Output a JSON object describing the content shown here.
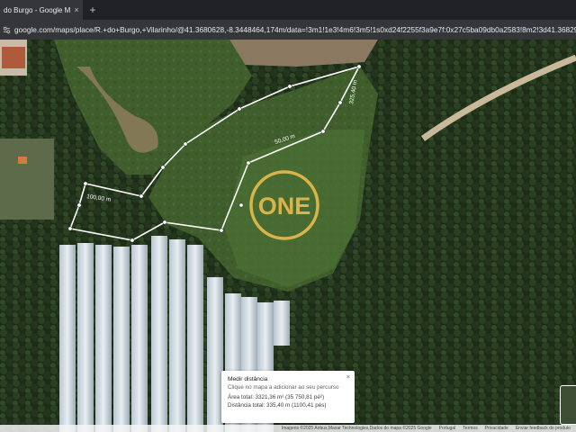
{
  "tab": {
    "title": "do Burgo - Google Maps",
    "close": "×",
    "new": "+"
  },
  "address": {
    "url": "google.com/maps/place/R.+do+Burgo,+Vilarinho/@41.3680628,-8.3448464,174m/data=!3m1!1e3!4m6!3m5!1s0xd24f2255f3a9e7f:0x27c5ba09db0a2583!8m2!3d41.36829…"
  },
  "logo": {
    "text": "ONE",
    "color": "#d9b44a"
  },
  "measure": {
    "labels": [
      "50,00 m",
      "100,00 m",
      "325,40 m"
    ],
    "line_color": "#ffffff"
  },
  "card": {
    "title": "Medir distância",
    "hint": "Clique no mapa a adicionar ao seu percurso",
    "area": "Área total: 3321,36 m² (35 750,81 pé²)",
    "distance": "Distância total: 335,40 m (1100,41 pés)",
    "close": "×"
  },
  "footer": {
    "attribution": "Imagens ©2025 Airbus,Maxar Technologies,Dados do mapa ©2025 Google",
    "country": "Portugal",
    "terms": "Termos",
    "privacy": "Privacidade",
    "feedback": "Enviar feedback do produto"
  }
}
